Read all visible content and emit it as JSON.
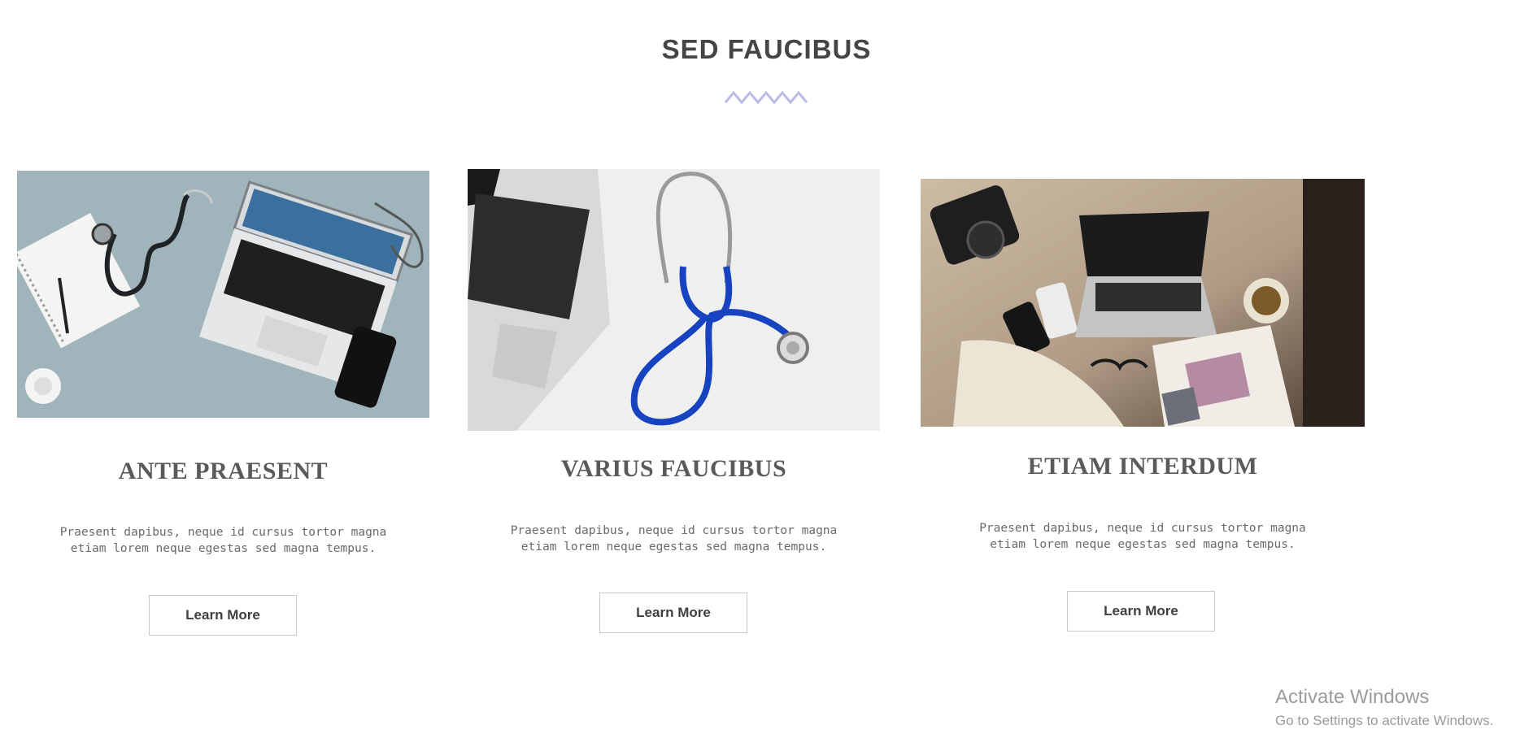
{
  "section": {
    "title": "SED FAUCIBUS",
    "accent_color": "#b9bce6"
  },
  "cards": [
    {
      "title": "ANTE PRAESENT",
      "text_line1": "Praesent dapibus, neque id cursus tortor magna",
      "text_line2": "etiam lorem neque egestas sed magna tempus.",
      "button_label": "Learn More",
      "image": "laptop-stethoscope-desk-photo"
    },
    {
      "title": "VARIUS FAUCIBUS",
      "text_line1": "Praesent dapibus, neque id cursus tortor magna",
      "text_line2": "etiam lorem neque egestas sed magna tempus.",
      "button_label": "Learn More",
      "image": "blue-stethoscope-laptop-photo"
    },
    {
      "title": "ETIAM INTERDUM",
      "text_line1": "Praesent dapibus, neque id cursus tortor magna",
      "text_line2": "etiam lorem neque egestas sed magna tempus.",
      "button_label": "Learn More",
      "image": "laptop-camera-magazine-photo"
    }
  ],
  "watermark": {
    "title": "Activate Windows",
    "subtitle": "Go to Settings to activate Windows."
  }
}
